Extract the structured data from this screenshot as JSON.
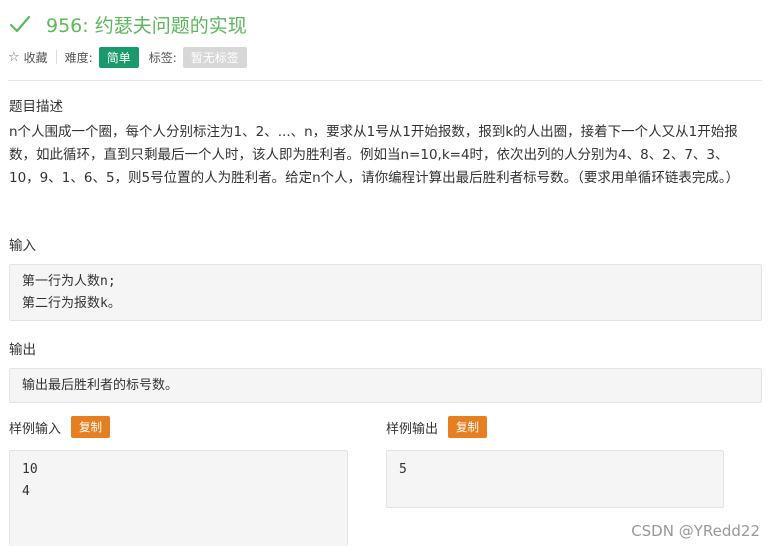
{
  "header": {
    "title": "956: 约瑟夫问题的实现",
    "favorite_label": "收藏",
    "difficulty_label": "难度:",
    "difficulty_value": "简单",
    "tags_label": "标签:",
    "tags_value": "暂无标签"
  },
  "description": {
    "heading": "题目描述",
    "text": "n个人围成一个圈，每个人分别标注为1、2、...、n，要求从1号从1开始报数，报到k的人出圈，接着下一个人又从1开始报数，如此循环，直到只剩最后一个人时，该人即为胜利者。例如当n=10,k=4时，依次出列的人分别为4、8、2、7、3、10，9、1、6、5，则5号位置的人为胜利者。给定n个人，请你编程计算出最后胜利者标号数。（要求用单循环链表完成。）"
  },
  "input": {
    "heading": "输入",
    "lines": [
      "第一行为人数n;",
      "第二行为报数k。"
    ]
  },
  "output": {
    "heading": "输出",
    "lines": [
      "输出最后胜利者的标号数。"
    ]
  },
  "sample_input": {
    "heading": "样例输入",
    "copy_label": "复制",
    "lines": [
      "10",
      "4"
    ]
  },
  "sample_output": {
    "heading": "样例输出",
    "copy_label": "复制",
    "lines": [
      "5"
    ]
  },
  "watermark": "CSDN @YRedd22",
  "colors": {
    "title": "#5cb85c",
    "difficulty": "#1a9a6a",
    "copy": "#e67e22",
    "tag": "#d7d7d7"
  }
}
